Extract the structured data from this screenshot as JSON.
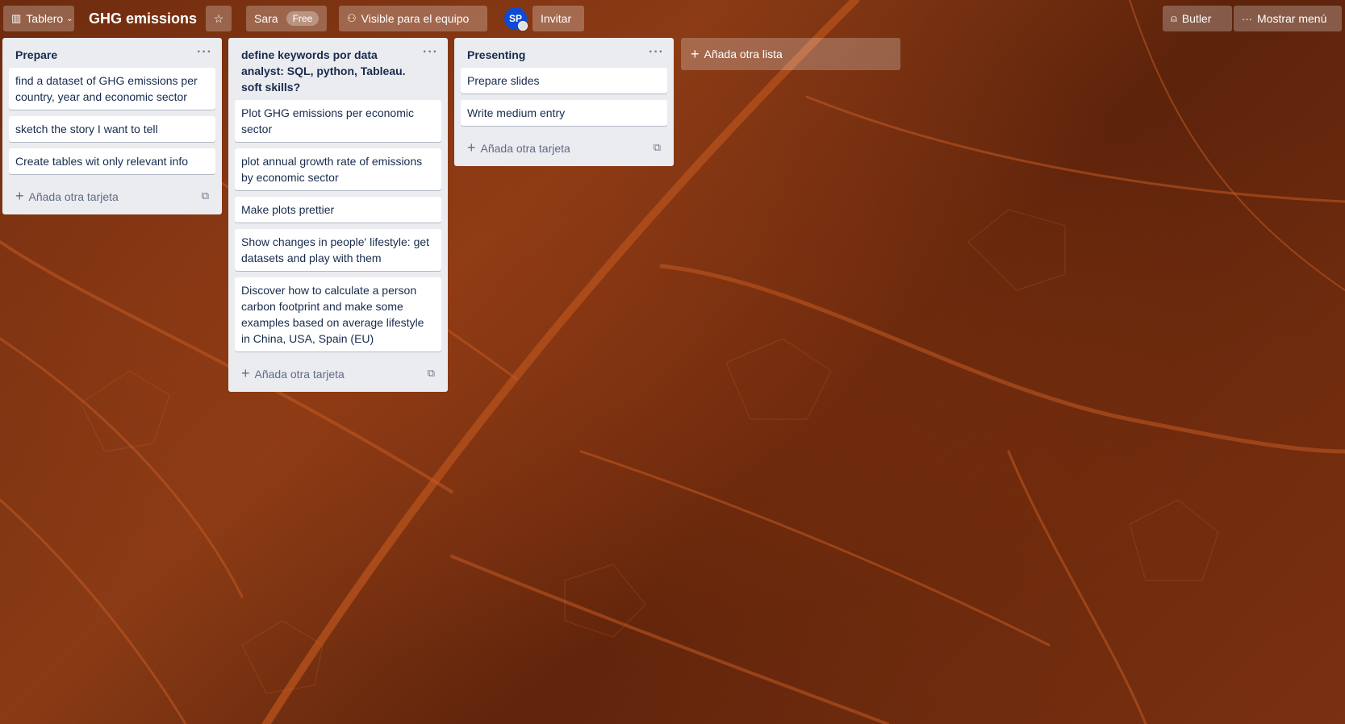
{
  "header": {
    "board_menu_label": "Tablero",
    "board_title": "GHG emissions",
    "team_name": "Sara",
    "team_plan": "Free",
    "visibility_label": "Visible para el equipo",
    "avatar_initials": "SP",
    "invite_label": "Invitar",
    "butler_label": "Butler",
    "show_menu_label": "Mostrar menú"
  },
  "lists": [
    {
      "title": "Prepare",
      "cards": [
        "find a dataset of GHG emissions per country, year and economic sector",
        "sketch the story I want to tell",
        "Create tables wit only relevant info"
      ],
      "add_card_label": "Añada otra tarjeta"
    },
    {
      "title": "define keywords por data analyst: SQL, python, Tableau. soft skills?",
      "cards": [
        "Plot GHG emissions per economic sector",
        "plot annual growth rate of emissions by economic sector",
        "Make plots prettier",
        "Show changes in people' lifestyle: get datasets and play with them",
        "Discover how to calculate a person carbon footprint and make some examples based on average lifestyle in China, USA, Spain (EU)"
      ],
      "add_card_label": "Añada otra tarjeta"
    },
    {
      "title": "Presenting",
      "cards": [
        "Prepare slides",
        "Write medium entry"
      ],
      "add_card_label": "Añada otra tarjeta"
    }
  ],
  "add_list_label": "Añada otra lista",
  "icons": {
    "board": "board-icon",
    "star": "star-icon",
    "visibility": "team-visibility-icon",
    "butler": "butler-bell-icon",
    "menu": "more-dots-icon",
    "template": "card-template-icon"
  },
  "colors": {
    "list_bg": "#ebecf0",
    "card_bg": "#ffffff",
    "avatar_bg": "#0d4bd6"
  }
}
